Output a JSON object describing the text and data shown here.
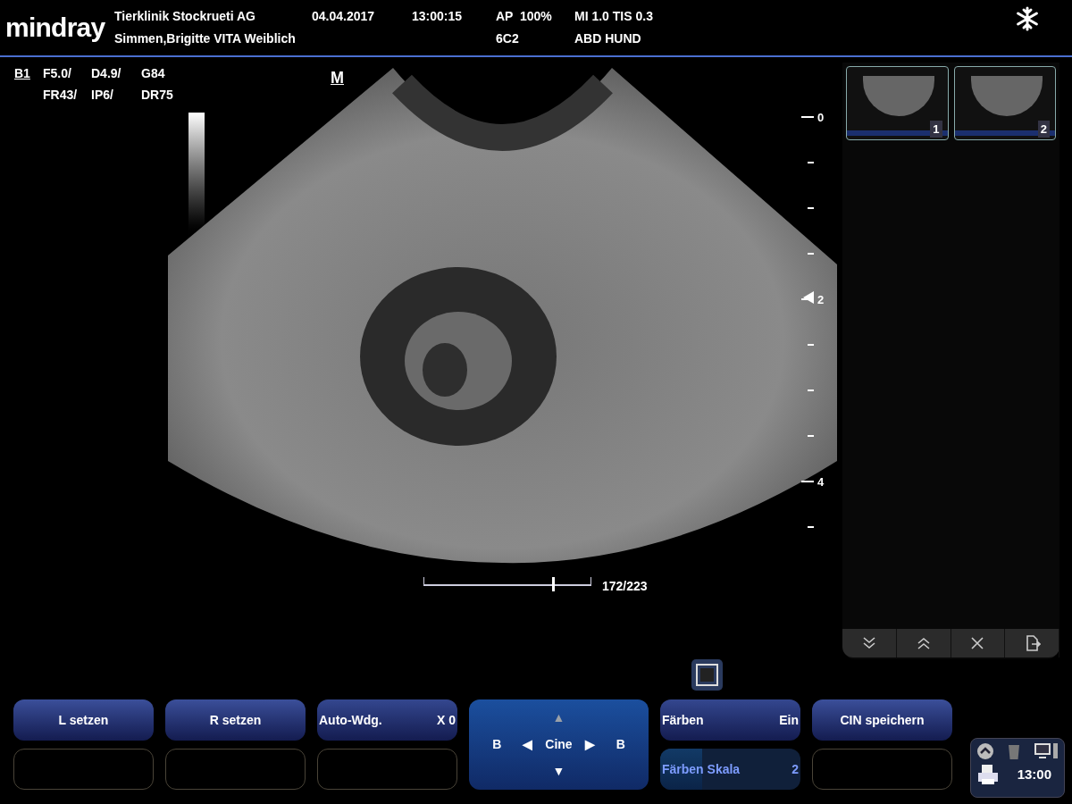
{
  "header": {
    "logo": "mindray",
    "institution": "Tierklinik Stockrueti AG",
    "patient": "Simmen,Brigitte VITA Weiblich",
    "date": "04.04.2017",
    "time": "13:00:15",
    "acoustic_power": "AP  100%",
    "indices": "MI 1.0 TIS 0.3",
    "probe": "6C2",
    "exam": "ABD HUND"
  },
  "parameters": {
    "mode": "B1",
    "row_1": [
      "F5.0/",
      "D4.9/",
      "G84"
    ],
    "row_2": [
      "FR43/",
      "IP6/",
      "DR75"
    ],
    "marker": "M"
  },
  "depth_scale": {
    "labels": [
      "0",
      "2",
      "4"
    ]
  },
  "cine": {
    "level": 0.77,
    "reading": "172/223"
  },
  "thumbnails": [
    {
      "label": "1"
    },
    {
      "label": "2"
    }
  ],
  "controls": [
    {
      "kind": "button",
      "label": "L setzen"
    },
    {
      "kind": "button",
      "label": "R setzen"
    },
    {
      "kind": "value",
      "label": "Auto-Wdg.",
      "value": "X 0"
    },
    {
      "kind": "value",
      "label": "Färben",
      "value": "Ein"
    },
    {
      "kind": "button",
      "label": "CIN speichern"
    }
  ],
  "controls_row_2": [
    {
      "kind": "empty"
    },
    {
      "kind": "empty"
    },
    {
      "kind": "empty"
    },
    {
      "kind": "level",
      "label": "Färben Skala",
      "value": "2",
      "level": 0.3
    },
    {
      "kind": "empty"
    }
  ],
  "cine_control": {
    "up": {
      "glyph": "▲",
      "disabled": true
    },
    "down": {
      "glyph": "▼",
      "disabled": false
    },
    "left_letter": "B",
    "left_glyph": "◀",
    "label": "Cine",
    "right_glyph": "▶",
    "right_letter": "B"
  },
  "status": {
    "clock": "13:00"
  }
}
